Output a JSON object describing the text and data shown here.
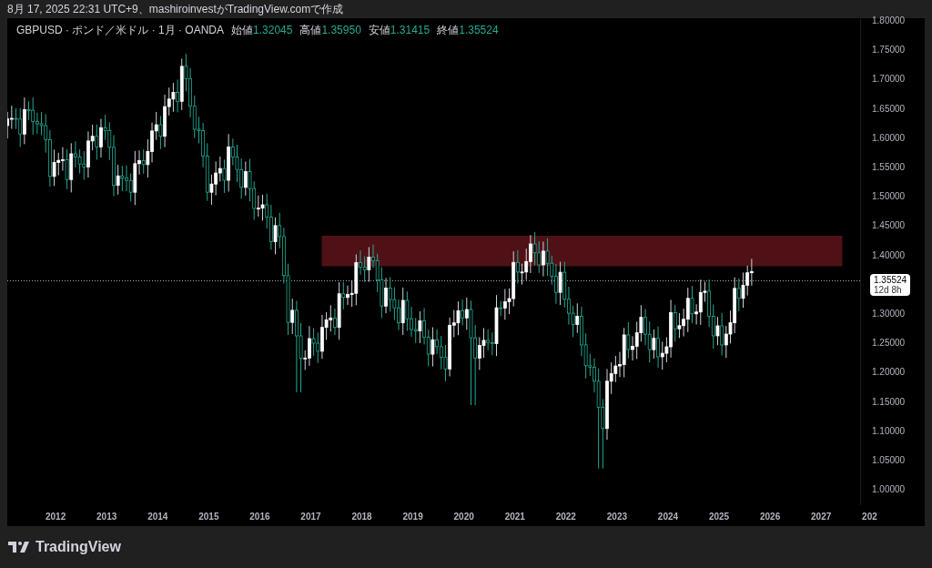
{
  "caption": "8月 17, 2025 22:31 UTC+9、mashiroinvestがTradingView.comで作成",
  "legend": {
    "symbol": "GBPUSD · ポンド／米ドル · 1月 · OANDA",
    "ohlc": [
      {
        "label": "始値",
        "value": "1.32045"
      },
      {
        "label": "高値",
        "value": "1.35950"
      },
      {
        "label": "安値",
        "value": "1.31415"
      },
      {
        "label": "終値",
        "value": "1.35524"
      }
    ]
  },
  "chart": {
    "price_ticks": [
      "1.80000",
      "1.75000",
      "1.70000",
      "1.65000",
      "1.60000",
      "1.55000",
      "1.50000",
      "1.45000",
      "1.40000",
      "1.30000",
      "1.25000",
      "1.20000",
      "1.15000",
      "1.10000",
      "1.05000",
      "1.00000"
    ],
    "year_ticks": [
      "2012",
      "2013",
      "2014",
      "2015",
      "2016",
      "2017",
      "2018",
      "2019",
      "2020",
      "2021",
      "2022",
      "2023",
      "2024",
      "2025",
      "2026",
      "2027",
      "202"
    ],
    "last_price": "1.35524",
    "countdown": "12d 8h"
  },
  "footer": {
    "brand": "TradingView"
  }
}
